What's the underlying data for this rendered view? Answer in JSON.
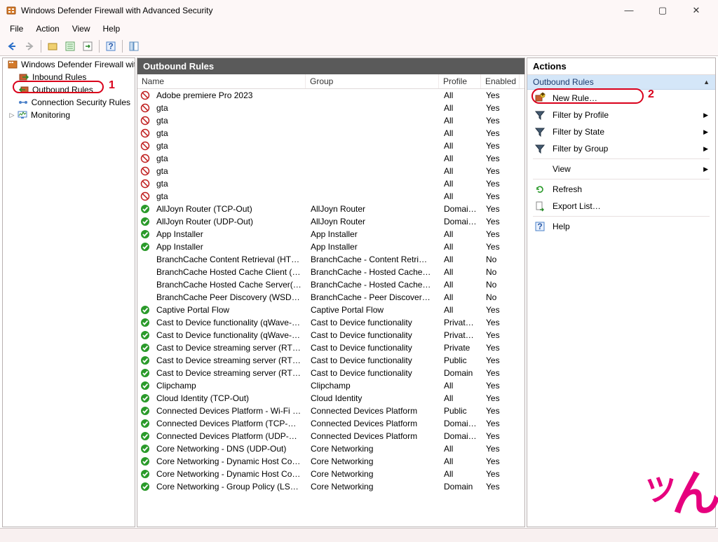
{
  "window": {
    "title": "Windows Defender Firewall with Advanced Security"
  },
  "menubar": [
    "File",
    "Action",
    "View",
    "Help"
  ],
  "tree": {
    "root": "Windows Defender Firewall with",
    "items": [
      {
        "label": "Inbound Rules",
        "icon": "inbound"
      },
      {
        "label": "Outbound Rules",
        "icon": "outbound",
        "selected": true
      },
      {
        "label": "Connection Security Rules",
        "icon": "conn"
      },
      {
        "label": "Monitoring",
        "icon": "monitor",
        "expandable": true
      }
    ]
  },
  "center": {
    "title": "Outbound Rules",
    "columns": [
      "Name",
      "Group",
      "Profile",
      "Enabled"
    ],
    "rules": [
      {
        "status": "block",
        "name": "Adobe premiere Pro 2023",
        "group": "",
        "profile": "All",
        "enabled": "Yes"
      },
      {
        "status": "block",
        "name": "gta",
        "group": "",
        "profile": "All",
        "enabled": "Yes"
      },
      {
        "status": "block",
        "name": "gta",
        "group": "",
        "profile": "All",
        "enabled": "Yes"
      },
      {
        "status": "block",
        "name": "gta",
        "group": "",
        "profile": "All",
        "enabled": "Yes"
      },
      {
        "status": "block",
        "name": "gta",
        "group": "",
        "profile": "All",
        "enabled": "Yes"
      },
      {
        "status": "block",
        "name": "gta",
        "group": "",
        "profile": "All",
        "enabled": "Yes"
      },
      {
        "status": "block",
        "name": "gta",
        "group": "",
        "profile": "All",
        "enabled": "Yes"
      },
      {
        "status": "block",
        "name": "gta",
        "group": "",
        "profile": "All",
        "enabled": "Yes"
      },
      {
        "status": "block",
        "name": "gta",
        "group": "",
        "profile": "All",
        "enabled": "Yes"
      },
      {
        "status": "allow",
        "name": "AllJoyn Router (TCP-Out)",
        "group": "AllJoyn Router",
        "profile": "Domai…",
        "enabled": "Yes"
      },
      {
        "status": "allow",
        "name": "AllJoyn Router (UDP-Out)",
        "group": "AllJoyn Router",
        "profile": "Domai…",
        "enabled": "Yes"
      },
      {
        "status": "allow",
        "name": "App Installer",
        "group": "App Installer",
        "profile": "All",
        "enabled": "Yes"
      },
      {
        "status": "allow",
        "name": "App Installer",
        "group": "App Installer",
        "profile": "All",
        "enabled": "Yes"
      },
      {
        "status": "none",
        "name": "BranchCache Content Retrieval (HTTP-Out)",
        "group": "BranchCache - Content Retri…",
        "profile": "All",
        "enabled": "No"
      },
      {
        "status": "none",
        "name": "BranchCache Hosted Cache Client (HTTP-…",
        "group": "BranchCache - Hosted Cache…",
        "profile": "All",
        "enabled": "No"
      },
      {
        "status": "none",
        "name": "BranchCache Hosted Cache Server(HTTP-…",
        "group": "BranchCache - Hosted Cache…",
        "profile": "All",
        "enabled": "No"
      },
      {
        "status": "none",
        "name": "BranchCache Peer Discovery (WSD-Out)",
        "group": "BranchCache - Peer Discover…",
        "profile": "All",
        "enabled": "No"
      },
      {
        "status": "allow",
        "name": "Captive Portal Flow",
        "group": "Captive Portal Flow",
        "profile": "All",
        "enabled": "Yes"
      },
      {
        "status": "allow",
        "name": "Cast to Device functionality (qWave-TCP-…",
        "group": "Cast to Device functionality",
        "profile": "Private,…",
        "enabled": "Yes"
      },
      {
        "status": "allow",
        "name": "Cast to Device functionality (qWave-UDP-…",
        "group": "Cast to Device functionality",
        "profile": "Private,…",
        "enabled": "Yes"
      },
      {
        "status": "allow",
        "name": "Cast to Device streaming server (RTP-Strea…",
        "group": "Cast to Device functionality",
        "profile": "Private",
        "enabled": "Yes"
      },
      {
        "status": "allow",
        "name": "Cast to Device streaming server (RTP-Strea…",
        "group": "Cast to Device functionality",
        "profile": "Public",
        "enabled": "Yes"
      },
      {
        "status": "allow",
        "name": "Cast to Device streaming server (RTP-Strea…",
        "group": "Cast to Device functionality",
        "profile": "Domain",
        "enabled": "Yes"
      },
      {
        "status": "allow",
        "name": "Clipchamp",
        "group": "Clipchamp",
        "profile": "All",
        "enabled": "Yes"
      },
      {
        "status": "allow",
        "name": "Cloud Identity (TCP-Out)",
        "group": "Cloud Identity",
        "profile": "All",
        "enabled": "Yes"
      },
      {
        "status": "allow",
        "name": "Connected Devices Platform - Wi-Fi Direct…",
        "group": "Connected Devices Platform",
        "profile": "Public",
        "enabled": "Yes"
      },
      {
        "status": "allow",
        "name": "Connected Devices Platform (TCP-Out)",
        "group": "Connected Devices Platform",
        "profile": "Domai…",
        "enabled": "Yes"
      },
      {
        "status": "allow",
        "name": "Connected Devices Platform (UDP-Out)",
        "group": "Connected Devices Platform",
        "profile": "Domai…",
        "enabled": "Yes"
      },
      {
        "status": "allow",
        "name": "Core Networking - DNS (UDP-Out)",
        "group": "Core Networking",
        "profile": "All",
        "enabled": "Yes"
      },
      {
        "status": "allow",
        "name": "Core Networking - Dynamic Host Configu…",
        "group": "Core Networking",
        "profile": "All",
        "enabled": "Yes"
      },
      {
        "status": "allow",
        "name": "Core Networking - Dynamic Host Configu…",
        "group": "Core Networking",
        "profile": "All",
        "enabled": "Yes"
      },
      {
        "status": "allow",
        "name": "Core Networking - Group Policy (LSASS-O…",
        "group": "Core Networking",
        "profile": "Domain",
        "enabled": "Yes"
      }
    ]
  },
  "actions": {
    "title": "Actions",
    "subhead": "Outbound Rules",
    "items": [
      {
        "label": "New Rule…",
        "icon": "new-rule"
      },
      {
        "label": "Filter by Profile",
        "icon": "filter",
        "submenu": true
      },
      {
        "label": "Filter by State",
        "icon": "filter",
        "submenu": true
      },
      {
        "label": "Filter by Group",
        "icon": "filter",
        "submenu": true
      },
      {
        "sep": true
      },
      {
        "label": "View",
        "icon": "",
        "submenu": true
      },
      {
        "sep": true
      },
      {
        "label": "Refresh",
        "icon": "refresh"
      },
      {
        "label": "Export List…",
        "icon": "export"
      },
      {
        "sep": true
      },
      {
        "label": "Help",
        "icon": "help"
      }
    ]
  },
  "annotations": {
    "one": "1",
    "two": "2"
  }
}
